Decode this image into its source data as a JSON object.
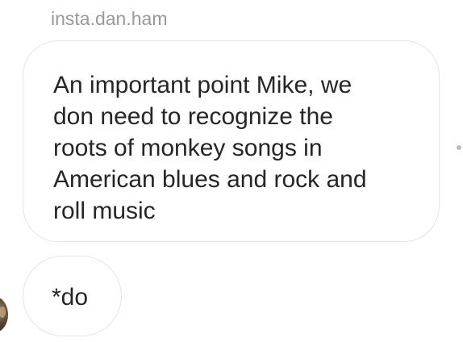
{
  "conversation": {
    "sender_username": "insta.dan.ham",
    "messages": [
      {
        "lines": [
          "An important point Mike, we",
          "don need to recognize the",
          "roots of monkey songs in",
          "American blues and rock and",
          "roll music"
        ]
      },
      {
        "lines": [
          "*do"
        ]
      }
    ]
  },
  "icons": {
    "options": "more-options-dot-icon",
    "avatar": "user-avatar"
  }
}
